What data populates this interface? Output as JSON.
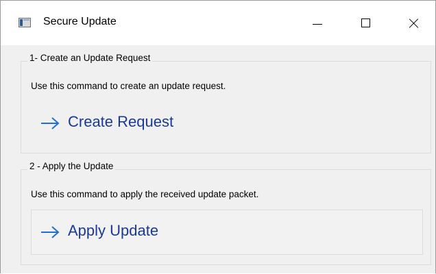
{
  "window": {
    "title": "Secure Update",
    "icon": "app-window-icon",
    "controls": {
      "minimize": "minimize-icon",
      "maximize": "maximize-icon",
      "close": "close-icon"
    }
  },
  "groups": [
    {
      "label": "1- Create an Update Request",
      "description": "Use this command to create an update request.",
      "command": {
        "icon": "arrow-right-icon",
        "label": "Create Request"
      }
    },
    {
      "label": "2 - Apply the Update",
      "description": "Use this command to apply the received update packet.",
      "command": {
        "icon": "arrow-right-icon",
        "label": "Apply Update"
      }
    }
  ],
  "colors": {
    "command_text": "#1a3a9a",
    "arrow": "#1e6fd8",
    "dialog_background": "#f0f0f0",
    "titlebar_background": "#ffffff"
  }
}
